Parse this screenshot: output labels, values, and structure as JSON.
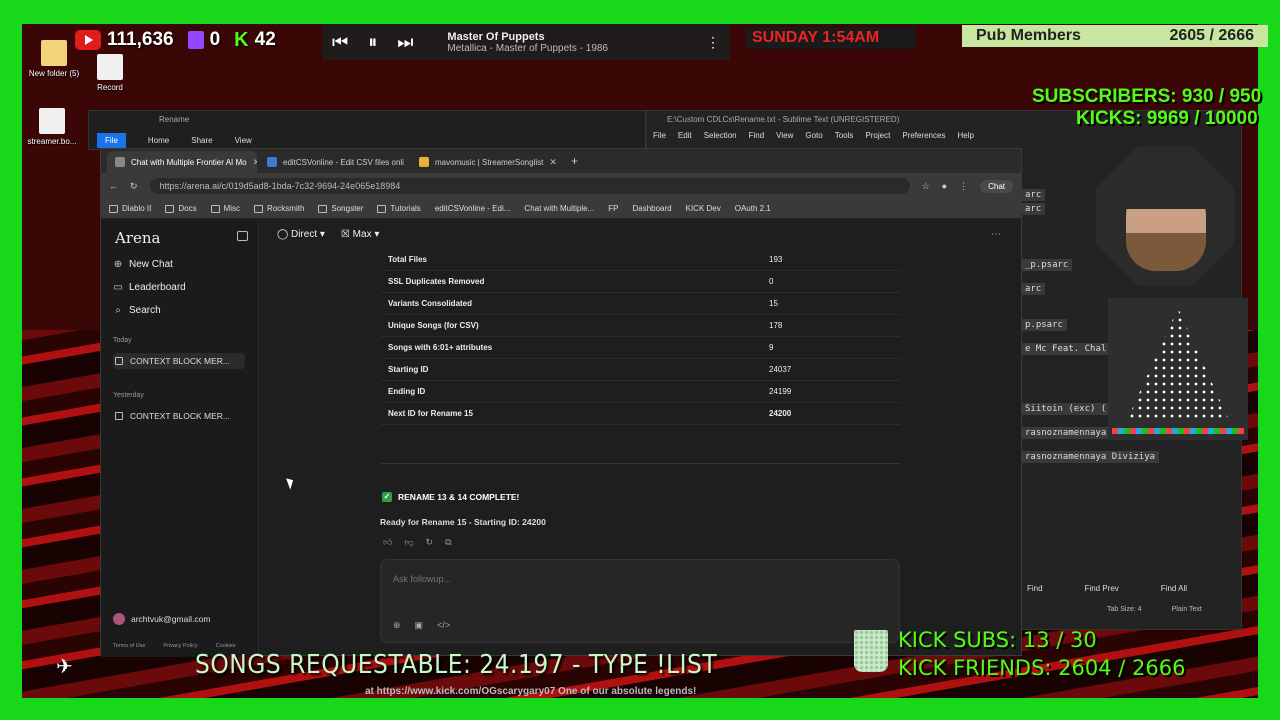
{
  "overlay": {
    "youtube_subs": "111,636",
    "twitch_viewers": "0",
    "kick_viewers": "42",
    "clock": "SUNDAY 1:54AM",
    "pub_members_label": "Pub Members",
    "pub_members_value": "2605 / 2666",
    "subscribers_line": "SUBSCRIBERS: 930 / 950",
    "kicks_line": "KICKS: 9969 / 10000",
    "kick_subs": "KICK SUBS: 13 / 30",
    "kick_friends": "KICK FRIENDS: 2604 / 2666",
    "banner": "SONGS REQUESTABLE: 24.197 - TYPE !LIST",
    "ticker": "at https://www.kick.com/OGscarygary07 One of our absolute legends!"
  },
  "media": {
    "title": "Master Of Puppets",
    "subtitle": "Metallica - Master of Puppets - 1986"
  },
  "desktop": {
    "icons": [
      {
        "label": "New folder (5)"
      },
      {
        "label": "Record"
      },
      {
        "label": "streamer.bo..."
      }
    ]
  },
  "explorer": {
    "title": "Rename",
    "tabs": [
      "File",
      "Home",
      "Share",
      "View"
    ]
  },
  "sublime": {
    "title": "E:\\Custom CDLCs\\Rename.txt - Sublime Text (UNREGISTERED)",
    "menu": [
      "File",
      "Edit",
      "Selection",
      "Find",
      "View",
      "Goto",
      "Tools",
      "Project",
      "Preferences",
      "Help"
    ],
    "lines": [
      "arc",
      "arc",
      "_p.psarc",
      "arc",
      "p.psarc",
      "e Mc Feat. Chal",
      "Siitoin (exc) (",
      "rasnoznamennaya",
      "rasnoznamennaya Diviziya"
    ],
    "find_buttons": [
      "Find",
      "Find Prev",
      "Find All"
    ],
    "status": [
      "Tab Size: 4",
      "Plain Text"
    ]
  },
  "browser": {
    "tabs": [
      {
        "label": "Chat with Multiple Frontier AI Mo",
        "active": true
      },
      {
        "label": "editCSVonline - Edit CSV files onli",
        "active": false
      },
      {
        "label": "mavomusic | StreamerSonglist",
        "active": false
      }
    ],
    "url": "https://arena.ai/c/019d5ad8-1bda-7c32-9694-24e065e18984",
    "chat_label": "Chat",
    "bookmarks": [
      "Diablo II",
      "Docs",
      "Misc",
      "Rocksmith",
      "Songster",
      "Tutorials",
      "editCSVonline - Edi...",
      "Chat with Multiple...",
      "FP",
      "Dashboard",
      "KICK Dev",
      "OAuth 2.1"
    ]
  },
  "arena": {
    "logo": "Arena",
    "mode": "Direct",
    "model": "Max",
    "nav": [
      "New Chat",
      "Leaderboard",
      "Search"
    ],
    "today_label": "Today",
    "today_item": "CONTEXT BLOCK MER...",
    "yesterday_label": "Yesterday",
    "yesterday_item": "CONTEXT BLOCK MER...",
    "user_email": "archtvuk@gmail.com",
    "footer": [
      "Terms of Use",
      "Privacy Policy",
      "Cookies"
    ],
    "table": [
      {
        "k": "Total Files",
        "v": "193",
        "bold": false
      },
      {
        "k": "SSL Duplicates Removed",
        "v": "0",
        "bold": false
      },
      {
        "k": "Variants Consolidated",
        "v": "15",
        "bold": false
      },
      {
        "k": "Unique Songs (for CSV)",
        "v": "178",
        "bold": false
      },
      {
        "k": "Songs with 6:01+ attributes",
        "v": "9",
        "bold": false
      },
      {
        "k": "Starting ID",
        "v": "24037",
        "bold": false
      },
      {
        "k": "Ending ID",
        "v": "24199",
        "bold": false
      },
      {
        "k": "Next ID for Rename 15",
        "v": "24200",
        "bold": true
      }
    ],
    "complete": "RENAME 13 & 14 COMPLETE!",
    "ready": "Ready for Rename 15 - Starting ID: 24200",
    "placeholder": "Ask followup..."
  }
}
